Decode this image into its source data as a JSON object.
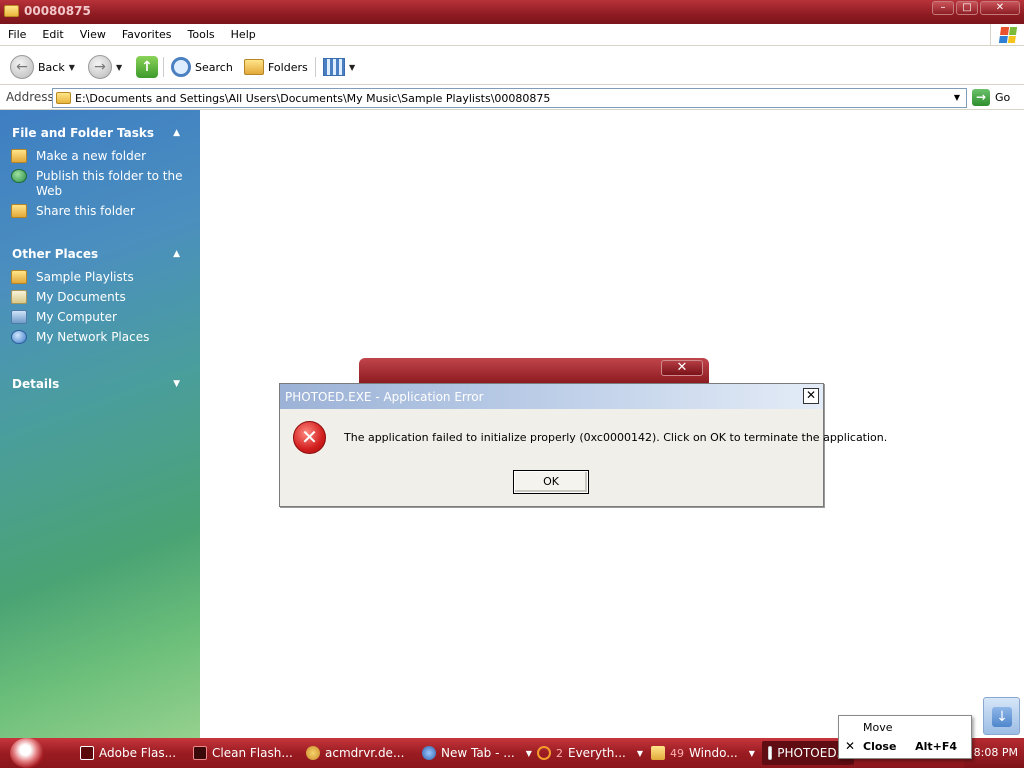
{
  "window": {
    "title": "00080875",
    "buttons": {
      "minimize": "–",
      "restore": "□",
      "close": "✕"
    }
  },
  "menu": [
    "File",
    "Edit",
    "View",
    "Favorites",
    "Tools",
    "Help"
  ],
  "toolbar": {
    "back": "Back",
    "search": "Search",
    "folders": "Folders"
  },
  "address": {
    "label": "Address",
    "path": "E:\\Documents and Settings\\All Users\\Documents\\My Music\\Sample Playlists\\00080875",
    "go": "Go"
  },
  "taskpane": {
    "file_tasks": {
      "title": "File and Folder Tasks",
      "items": [
        "Make a new folder",
        "Publish this folder to the Web",
        "Share this folder"
      ]
    },
    "other_places": {
      "title": "Other Places",
      "items": [
        "Sample Playlists",
        "My Documents",
        "My Computer",
        "My Network Places"
      ]
    },
    "details": {
      "title": "Details"
    }
  },
  "dialog": {
    "title": "PHOTOED.EXE - Application Error",
    "message": "The application failed to initialize properly (0xc0000142). Click on OK to terminate the application.",
    "ok": "OK",
    "close": "✕"
  },
  "taskbar": {
    "items": [
      {
        "label": "Adobe Flas...",
        "count": ""
      },
      {
        "label": "Clean Flash...",
        "count": ""
      },
      {
        "label": "acmdrvr.de...",
        "count": ""
      },
      {
        "label": "New Tab - ...",
        "count": ""
      },
      {
        "label": "Everyth...",
        "count": "2"
      },
      {
        "label": "Windo...",
        "count": "49"
      },
      {
        "label": "PHOTOED...",
        "count": ""
      }
    ],
    "clock": "8:08 PM"
  },
  "context_menu": {
    "items": [
      {
        "label": "Move",
        "accel": ""
      },
      {
        "label": "Close",
        "accel": "Alt+F4"
      }
    ]
  },
  "colors": {
    "titlebar": "#8e1b22",
    "taskpane_top": "#3e7ec3",
    "taskpane_bottom": "#95d18e",
    "dialog_title": "#9cb2d6",
    "error_icon": "#d21e1e"
  }
}
